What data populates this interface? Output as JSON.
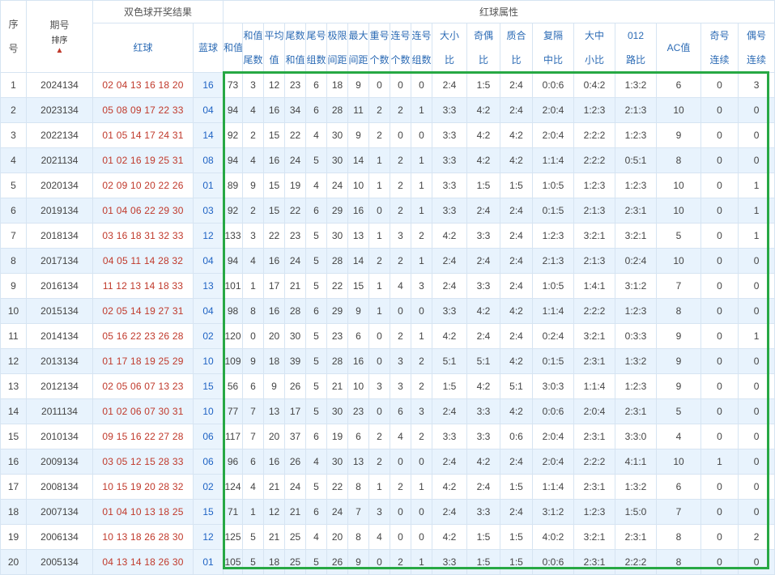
{
  "header": {
    "seq": "序号",
    "period": "期号",
    "sort": "排序",
    "result_group": "双色球开奖结果",
    "red": "红球",
    "blue": "蓝球",
    "attr_group": "红球属性",
    "cols": [
      [
        "和值"
      ],
      [
        "和值",
        "尾数"
      ],
      [
        "平均",
        "值"
      ],
      [
        "尾数",
        "和值"
      ],
      [
        "尾号",
        "组数"
      ],
      [
        "极限",
        "间距"
      ],
      [
        "最大",
        "间距"
      ],
      [
        "重号",
        "个数"
      ],
      [
        "连号",
        "个数"
      ],
      [
        "连号",
        "组数"
      ],
      [
        "大小",
        "比"
      ],
      [
        "奇偶",
        "比"
      ],
      [
        "质合",
        "比"
      ],
      [
        "复隔",
        "中比"
      ],
      [
        "大中",
        "小比"
      ],
      [
        "012",
        "路比"
      ],
      [
        "AC值"
      ],
      [
        "奇号",
        "连续"
      ],
      [
        "偶号",
        "连续"
      ]
    ]
  },
  "rows": [
    [
      "1",
      "2024134",
      "02 04 13 16 18 20",
      "16",
      "73",
      "3",
      "12",
      "23",
      "6",
      "18",
      "9",
      "0",
      "0",
      "0",
      "2:4",
      "1:5",
      "2:4",
      "0:0:6",
      "0:4:2",
      "1:3:2",
      "6",
      "0",
      "3"
    ],
    [
      "2",
      "2023134",
      "05 08 09 17 22 33",
      "04",
      "94",
      "4",
      "16",
      "34",
      "6",
      "28",
      "11",
      "2",
      "2",
      "1",
      "3:3",
      "4:2",
      "2:4",
      "2:0:4",
      "1:2:3",
      "2:1:3",
      "10",
      "0",
      "0"
    ],
    [
      "3",
      "2022134",
      "01 05 14 17 24 31",
      "14",
      "92",
      "2",
      "15",
      "22",
      "4",
      "30",
      "9",
      "2",
      "0",
      "0",
      "3:3",
      "4:2",
      "4:2",
      "2:0:4",
      "2:2:2",
      "1:2:3",
      "9",
      "0",
      "0"
    ],
    [
      "4",
      "2021134",
      "01 02 16 19 25 31",
      "08",
      "94",
      "4",
      "16",
      "24",
      "5",
      "30",
      "14",
      "1",
      "2",
      "1",
      "3:3",
      "4:2",
      "4:2",
      "1:1:4",
      "2:2:2",
      "0:5:1",
      "8",
      "0",
      "0"
    ],
    [
      "5",
      "2020134",
      "02 09 10 20 22 26",
      "01",
      "89",
      "9",
      "15",
      "19",
      "4",
      "24",
      "10",
      "1",
      "2",
      "1",
      "3:3",
      "1:5",
      "1:5",
      "1:0:5",
      "1:2:3",
      "1:2:3",
      "10",
      "0",
      "1"
    ],
    [
      "6",
      "2019134",
      "01 04 06 22 29 30",
      "03",
      "92",
      "2",
      "15",
      "22",
      "6",
      "29",
      "16",
      "0",
      "2",
      "1",
      "3:3",
      "2:4",
      "2:4",
      "0:1:5",
      "2:1:3",
      "2:3:1",
      "10",
      "0",
      "1"
    ],
    [
      "7",
      "2018134",
      "03 16 18 31 32 33",
      "12",
      "133",
      "3",
      "22",
      "23",
      "5",
      "30",
      "13",
      "1",
      "3",
      "2",
      "4:2",
      "3:3",
      "2:4",
      "1:2:3",
      "3:2:1",
      "3:2:1",
      "5",
      "0",
      "1"
    ],
    [
      "8",
      "2017134",
      "04 05 11 14 28 32",
      "04",
      "94",
      "4",
      "16",
      "24",
      "5",
      "28",
      "14",
      "2",
      "2",
      "1",
      "2:4",
      "2:4",
      "2:4",
      "2:1:3",
      "2:1:3",
      "0:2:4",
      "10",
      "0",
      "0"
    ],
    [
      "9",
      "2016134",
      "11 12 13 14 18 33",
      "13",
      "101",
      "1",
      "17",
      "21",
      "5",
      "22",
      "15",
      "1",
      "4",
      "3",
      "2:4",
      "3:3",
      "2:4",
      "1:0:5",
      "1:4:1",
      "3:1:2",
      "7",
      "0",
      "0"
    ],
    [
      "10",
      "2015134",
      "02 05 14 19 27 31",
      "04",
      "98",
      "8",
      "16",
      "28",
      "6",
      "29",
      "9",
      "1",
      "0",
      "0",
      "3:3",
      "4:2",
      "4:2",
      "1:1:4",
      "2:2:2",
      "1:2:3",
      "8",
      "0",
      "0"
    ],
    [
      "11",
      "2014134",
      "05 16 22 23 26 28",
      "02",
      "120",
      "0",
      "20",
      "30",
      "5",
      "23",
      "6",
      "0",
      "2",
      "1",
      "4:2",
      "2:4",
      "2:4",
      "0:2:4",
      "3:2:1",
      "0:3:3",
      "9",
      "0",
      "1"
    ],
    [
      "12",
      "2013134",
      "01 17 18 19 25 29",
      "10",
      "109",
      "9",
      "18",
      "39",
      "5",
      "28",
      "16",
      "0",
      "3",
      "2",
      "5:1",
      "5:1",
      "4:2",
      "0:1:5",
      "2:3:1",
      "1:3:2",
      "9",
      "0",
      "0"
    ],
    [
      "13",
      "2012134",
      "02 05 06 07 13 23",
      "15",
      "56",
      "6",
      "9",
      "26",
      "5",
      "21",
      "10",
      "3",
      "3",
      "2",
      "1:5",
      "4:2",
      "5:1",
      "3:0:3",
      "1:1:4",
      "1:2:3",
      "9",
      "0",
      "0"
    ],
    [
      "14",
      "2011134",
      "01 02 06 07 30 31",
      "10",
      "77",
      "7",
      "13",
      "17",
      "5",
      "30",
      "23",
      "0",
      "6",
      "3",
      "2:4",
      "3:3",
      "4:2",
      "0:0:6",
      "2:0:4",
      "2:3:1",
      "5",
      "0",
      "0"
    ],
    [
      "15",
      "2010134",
      "09 15 16 22 27 28",
      "06",
      "117",
      "7",
      "20",
      "37",
      "6",
      "19",
      "6",
      "2",
      "4",
      "2",
      "3:3",
      "3:3",
      "0:6",
      "2:0:4",
      "2:3:1",
      "3:3:0",
      "4",
      "0",
      "0"
    ],
    [
      "16",
      "2009134",
      "03 05 12 15 28 33",
      "06",
      "96",
      "6",
      "16",
      "26",
      "4",
      "30",
      "13",
      "2",
      "0",
      "0",
      "2:4",
      "4:2",
      "2:4",
      "2:0:4",
      "2:2:2",
      "4:1:1",
      "10",
      "1",
      "0"
    ],
    [
      "17",
      "2008134",
      "10 15 19 20 28 32",
      "02",
      "124",
      "4",
      "21",
      "24",
      "5",
      "22",
      "8",
      "1",
      "2",
      "1",
      "4:2",
      "2:4",
      "1:5",
      "1:1:4",
      "2:3:1",
      "1:3:2",
      "6",
      "0",
      "0"
    ],
    [
      "18",
      "2007134",
      "01 04 10 13 18 25",
      "15",
      "71",
      "1",
      "12",
      "21",
      "6",
      "24",
      "7",
      "3",
      "0",
      "0",
      "2:4",
      "3:3",
      "2:4",
      "3:1:2",
      "1:2:3",
      "1:5:0",
      "7",
      "0",
      "0"
    ],
    [
      "19",
      "2006134",
      "10 13 18 26 28 30",
      "12",
      "125",
      "5",
      "21",
      "25",
      "4",
      "20",
      "8",
      "4",
      "0",
      "0",
      "4:2",
      "1:5",
      "1:5",
      "4:0:2",
      "3:2:1",
      "2:3:1",
      "8",
      "0",
      "2"
    ],
    [
      "20",
      "2005134",
      "04 13 14 18 26 30",
      "01",
      "105",
      "5",
      "18",
      "25",
      "5",
      "26",
      "9",
      "0",
      "2",
      "1",
      "3:3",
      "1:5",
      "1:5",
      "0:0:6",
      "2:3:1",
      "2:2:2",
      "8",
      "0",
      "0"
    ]
  ],
  "colors": {
    "red": "#c0392b",
    "blue": "#1f63c4",
    "highlight": "#27a844",
    "stripe": "#e8f3fd"
  },
  "icons": {
    "sort": "sort-up-arrow-icon"
  }
}
